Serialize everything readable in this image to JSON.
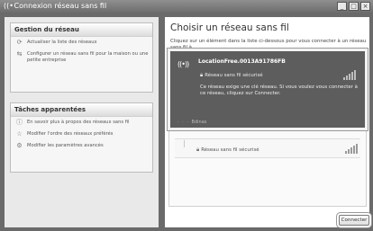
{
  "window": {
    "title": "Connexion réseau sans fil",
    "title_icon": "wireless-icon"
  },
  "sidebar": {
    "network_tasks": {
      "title": "Gestion du réseau",
      "items": [
        {
          "icon": "refresh-icon",
          "label": "Actualiser la liste des réseaux"
        },
        {
          "icon": "setup-icon",
          "label": "Configurer un réseau sans fil pour la maison ou une petite entreprise"
        }
      ]
    },
    "related_tasks": {
      "title": "Tâches apparentées",
      "items": [
        {
          "icon": "info-icon",
          "label": "En savoir plus à propos des réseaux sans fil"
        },
        {
          "icon": "star-icon",
          "label": "Modifier l'ordre des réseaux préférés"
        },
        {
          "icon": "settings-icon",
          "label": "Modifier les paramètres avancés"
        }
      ]
    }
  },
  "main": {
    "heading": "Choisir un réseau sans fil",
    "description": "Cliquez sur un élément dans la liste ci-dessous pour vous connecter à un réseau sans fil à",
    "networks": [
      {
        "ssid": "LocationFree.0013A91786FB",
        "security": "Réseau sans fil sécurisé",
        "help": "Ce réseau exige une clé réseau. Si vous voulez vous connecter à ce réseau, cliquez sur Connecter.",
        "signal_bars": 5,
        "selected": true,
        "footer_label": "Bdinas"
      },
      {
        "ssid": "",
        "security": "Réseau sans fil sécurisé",
        "signal_bars": 5,
        "selected": false
      }
    ],
    "connect_button": "Connecter"
  },
  "colors": {
    "selected_bg": "#5d5d5d",
    "sidebar_bg": "#e9e9e9",
    "frame_bg": "#6a6a6a"
  }
}
